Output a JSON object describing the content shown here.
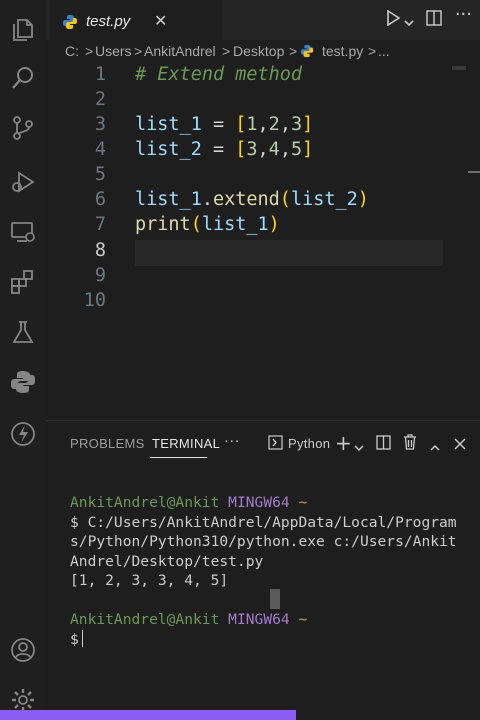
{
  "tab": {
    "filename": "test.py",
    "close": "✕"
  },
  "breadcrumb": {
    "parts": [
      "C:",
      "Users",
      "AnkitAndrel",
      "Desktop",
      "test.py",
      "..."
    ],
    "sep": ">"
  },
  "editor": {
    "lines": [
      {
        "num": "1"
      },
      {
        "num": "2"
      },
      {
        "num": "3"
      },
      {
        "num": "4"
      },
      {
        "num": "5"
      },
      {
        "num": "6"
      },
      {
        "num": "7"
      },
      {
        "num": "8"
      },
      {
        "num": "9"
      },
      {
        "num": "10"
      }
    ],
    "code": {
      "l1": "# Extend method",
      "l3_var": "list_1",
      "l3_op": " = ",
      "l3_open": "[",
      "l3_vals": [
        "1",
        "2",
        "3"
      ],
      "l3_close": "]",
      "l4_var": "list_2",
      "l4_op": " = ",
      "l4_open": "[",
      "l4_vals": [
        "3",
        "4",
        "5"
      ],
      "l4_close": "]",
      "l6_obj": "list_1",
      "l6_dot": ".",
      "l6_method": "extend",
      "l6_open": "(",
      "l6_arg": "list_2",
      "l6_close": ")",
      "l7_fn": "print",
      "l7_open": "(",
      "l7_arg": "list_1",
      "l7_close": ")",
      "comma": ","
    }
  },
  "panel": {
    "tabs": {
      "problems": "PROBLEMS",
      "terminal": "TERMINAL",
      "more": "···"
    },
    "shell_label": "Python",
    "terminal": {
      "user1": "AnkitAndrel@Ankit",
      "host1": "MINGW64",
      "tilde1": "~",
      "cmd_l1": "$ C:/Users/AnkitAndrel/AppData/Local/Program",
      "cmd_l2": "s/Python/Python310/python.exe c:/Users/Ankit",
      "cmd_l3": "Andrel/Desktop/test.py",
      "output": "[1, 2, 3, 3, 4, 5]",
      "user2": "AnkitAndrel@Ankit",
      "host2": "MINGW64",
      "tilde2": "~",
      "prompt": "$"
    }
  },
  "colors": {
    "accent_status": "#8b5cf6",
    "comment": "#6a9955",
    "bracket": "#ffd700",
    "number": "#b5cea8",
    "function": "#dcdcaa",
    "variable": "#9cdcfe"
  },
  "icons": {
    "activity": [
      "explorer-icon",
      "search-icon",
      "source-control-icon",
      "run-debug-icon",
      "remote-explorer-icon",
      "extensions-icon",
      "testing-icon",
      "python-icon",
      "thunder-icon",
      "account-icon",
      "settings-gear-icon"
    ],
    "tab_actions": [
      "run-icon",
      "chevron-down-icon",
      "split-editor-icon",
      "more-icon"
    ]
  }
}
